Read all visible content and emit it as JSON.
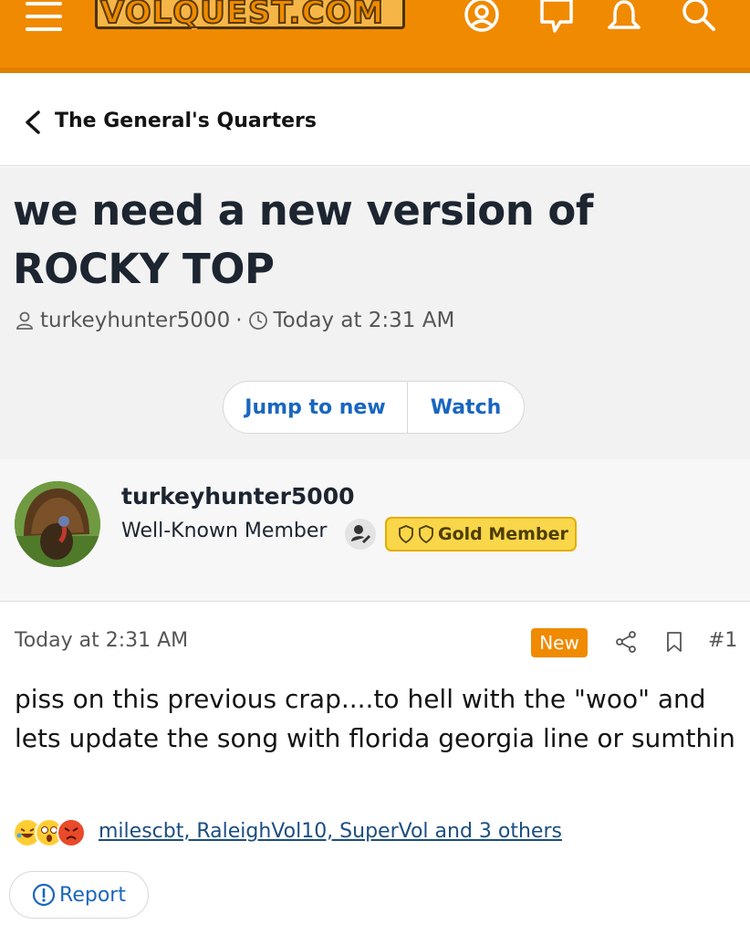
{
  "header": {
    "logo_text": "VOLQUEST.COM",
    "accent_color": "#f08a00",
    "icons": [
      "menu-icon",
      "account-icon",
      "conversations-icon",
      "alerts-icon",
      "search-icon"
    ]
  },
  "breadcrumb": {
    "label": "The General's Quarters"
  },
  "thread": {
    "title_line1": "we need a new version of",
    "title_line2": "ROCKY TOP",
    "author": "turkeyhunter5000",
    "separator": "·",
    "time": "Today at 2:31 AM",
    "jump_label": "Jump to new",
    "watch_label": "Watch"
  },
  "user": {
    "name": "turkeyhunter5000",
    "title": "Well-Known Member",
    "badge": "Gold Member"
  },
  "post": {
    "date": "Today at 2:31 AM",
    "new_label": "New",
    "number": "#1",
    "body": "piss on this previous crap....to hell with the \"woo\" and lets update the song with florida georgia line or sumthin",
    "reactions_text": "milescbt, RaleighVol10, SuperVol and 3 others",
    "report_label": "Report"
  }
}
